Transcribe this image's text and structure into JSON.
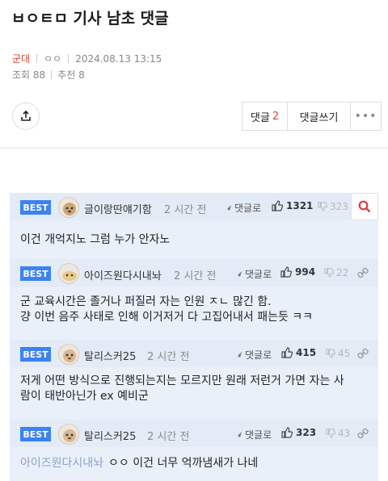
{
  "post": {
    "title": "ㅂㅇㅌㅁ 기사 남초 댓글",
    "category": "군대",
    "author": "ㅇㅇ",
    "datetime": "2024.08.13 13:15",
    "views_label": "조회 88",
    "recommend_label": "추천 8"
  },
  "actions": {
    "comment_label": "댓글",
    "comment_count": "2",
    "write_label": "댓글쓰기",
    "more_label": "•••"
  },
  "comments": [
    {
      "badge": "BEST",
      "nick": "글이랑딴얘기함",
      "time": "2 시간 전",
      "reply": "댓글로",
      "likes": "1321",
      "dislikes": "323",
      "lines": [
        "이건 개억지노 그럼 누가 안자노"
      ]
    },
    {
      "badge": "BEST",
      "nick": "아이즈원다시내놔",
      "time": "2 시간 전",
      "reply": "댓글로",
      "likes": "994",
      "dislikes": "22",
      "lines": [
        "군 교육시간은 졸거나 퍼질러 자는 인원 ㅈㄴ 많긴 함.",
        "걍 이번 음주 사태로 인해 이거저거 다 고집어내서 패는듯 ㅋㅋ"
      ]
    },
    {
      "badge": "BEST",
      "nick": "탈리스커25",
      "time": "2 시간 전",
      "reply": "댓글로",
      "likes": "415",
      "dislikes": "45",
      "lines": [
        "저게 어떤 방식으로 진행되는지는 모르지만 원래 저런거 가면 자는 사",
        "람이 태반아닌가 ex 예비군"
      ]
    },
    {
      "badge": "BEST",
      "nick": "탈리스커25",
      "time": "2 시간 전",
      "reply": "댓글로",
      "likes": "323",
      "dislikes": "43",
      "sub_nick": "아이즈원다시내놔",
      "lines": [
        "ㅇㅇ 이건 너무 억까냄새가 나네"
      ]
    }
  ],
  "colors": {
    "accent_red": "#d9442b",
    "badge_blue": "#3c82f2",
    "comment_bg": "#e9f0fa",
    "search_red": "#e03a3a"
  },
  "icons": [
    "share-icon",
    "search-icon",
    "reply-arrow-icon",
    "thumbs-up-icon",
    "thumbs-down-icon",
    "link-icon"
  ]
}
